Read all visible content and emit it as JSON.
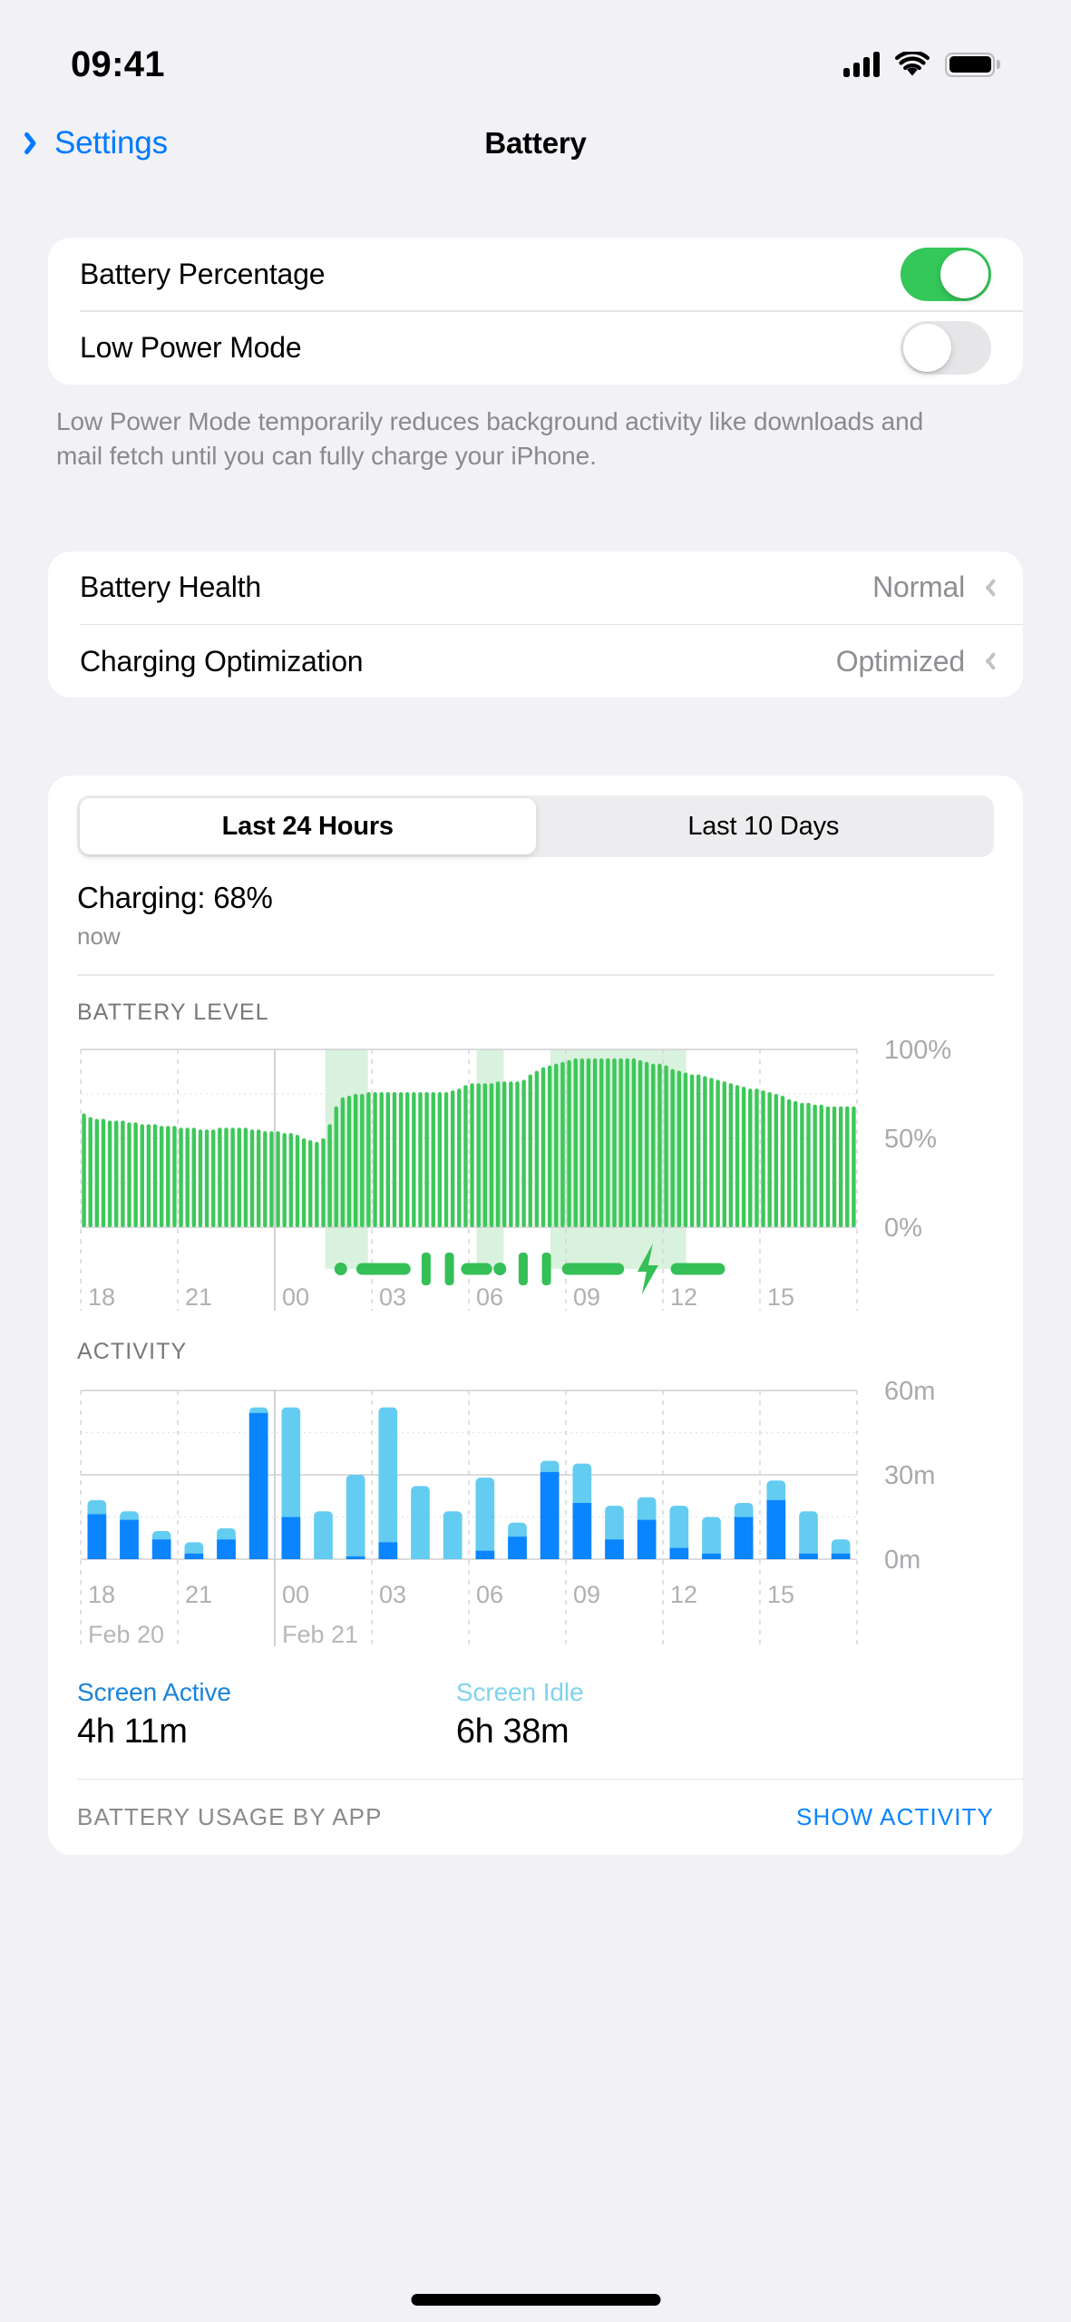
{
  "status_bar": {
    "time": "09:41",
    "cellular_icon": "cellular-bars-icon",
    "wifi_icon": "wifi-icon",
    "battery_icon": "battery-full-icon"
  },
  "nav": {
    "back_label": "Settings",
    "title": "Battery"
  },
  "settings_card": {
    "rows": [
      {
        "label": "Battery Percentage",
        "toggle": "on"
      },
      {
        "label": "Low Power Mode",
        "toggle": "off"
      }
    ]
  },
  "footnote": "Low Power Mode temporarily reduces background activity like downloads and mail fetch until you can fully charge your iPhone.",
  "health_card": {
    "rows": [
      {
        "label": "Battery Health",
        "value": "Normal"
      },
      {
        "label": "Charging Optimization",
        "value": "Optimized"
      }
    ]
  },
  "usage": {
    "segments": [
      {
        "label": "Last 24 Hours",
        "selected": true
      },
      {
        "label": "Last 10 Days",
        "selected": false
      }
    ],
    "charging_status": "Charging: 68%",
    "charging_time": "now",
    "battery_level_title": "BATTERY LEVEL",
    "activity_title": "ACTIVITY",
    "legend": [
      {
        "name": "Screen Active",
        "value": "4h 11m",
        "color": "#1a84d8"
      },
      {
        "name": "Screen Idle",
        "value": "6h 38m",
        "color": "#7fd3ea"
      }
    ],
    "by_app_title": "BATTERY USAGE BY APP",
    "show_activity_label": "SHOW ACTIVITY"
  },
  "colors": {
    "accent": "#007aff",
    "toggle_on": "#34c759",
    "battery_green": "#3ec75a",
    "screen_active": "#0a84ff",
    "screen_idle": "#64ccf0",
    "background": "#f1f1f6"
  },
  "chart_data": [
    {
      "type": "bar",
      "title": "BATTERY LEVEL",
      "ylabel": "",
      "ylim": [
        0,
        100
      ],
      "ytick_labels": [
        "100%",
        "50%",
        "0%"
      ],
      "ytick_values": [
        100,
        50,
        0
      ],
      "xlabel": "",
      "xtick_labels": [
        "18",
        "21",
        "00",
        "03",
        "06",
        "09",
        "12",
        "15"
      ],
      "grid": true,
      "bar_color": "#3ec75a",
      "values": [
        64,
        62,
        61,
        61,
        60,
        60,
        60,
        59,
        59,
        58,
        58,
        58,
        57,
        57,
        57,
        56,
        56,
        56,
        55,
        55,
        55,
        56,
        56,
        56,
        56,
        56,
        55,
        55,
        54,
        54,
        54,
        53,
        53,
        52,
        50,
        49,
        48,
        50,
        58,
        68,
        73,
        74,
        75,
        75,
        76,
        76,
        76,
        76,
        76,
        76,
        76,
        76,
        76,
        76,
        76,
        76,
        76,
        77,
        78,
        80,
        81,
        81,
        81,
        81,
        82,
        82,
        82,
        82,
        83,
        86,
        88,
        90,
        91,
        92,
        93,
        94,
        95,
        95,
        95,
        95,
        95,
        95,
        95,
        95,
        95,
        95,
        94,
        93,
        92,
        92,
        91,
        89,
        88,
        87,
        86,
        86,
        85,
        84,
        83,
        82,
        81,
        80,
        79,
        78,
        78,
        77,
        76,
        75,
        74,
        72,
        71,
        70,
        70,
        69,
        69,
        68,
        68,
        68,
        68,
        68
      ],
      "charging_regions": [
        {
          "start_pct": 31.5,
          "end_pct": 37.0
        },
        {
          "start_pct": 51.0,
          "end_pct": 54.5
        },
        {
          "start_pct": 60.5,
          "end_pct": 78.0
        }
      ],
      "charging_markers": [
        {
          "type": "dot",
          "pos_pct": 33.5
        },
        {
          "type": "line",
          "start_pct": 35.5,
          "end_pct": 42.5
        },
        {
          "type": "pause",
          "pos_pct": 44.5
        },
        {
          "type": "pause",
          "pos_pct": 47.5
        },
        {
          "type": "line",
          "start_pct": 49.0,
          "end_pct": 53.0
        },
        {
          "type": "dot",
          "pos_pct": 54.0
        },
        {
          "type": "pause",
          "pos_pct": 57.0
        },
        {
          "type": "pause",
          "pos_pct": 60.0
        },
        {
          "type": "line",
          "start_pct": 62.0,
          "end_pct": 70.0
        },
        {
          "type": "bolt",
          "pos_pct": 73.0
        },
        {
          "type": "line",
          "start_pct": 76.0,
          "end_pct": 83.0
        }
      ]
    },
    {
      "type": "bar",
      "title": "ACTIVITY",
      "ylabel": "",
      "ylim": [
        0,
        60
      ],
      "ytick_labels": [
        "60m",
        "30m",
        "0m"
      ],
      "ytick_values": [
        60,
        30,
        0
      ],
      "xlabel": "",
      "xtick_labels": [
        "18",
        "21",
        "00",
        "03",
        "06",
        "09",
        "12",
        "15"
      ],
      "date_labels": [
        "Feb 20",
        "Feb 21"
      ],
      "grid": true,
      "stacked": true,
      "series": [
        {
          "name": "Screen Active",
          "color": "#0a84ff",
          "values": [
            16,
            14,
            7,
            2,
            7,
            52,
            15,
            0,
            1,
            6,
            0,
            0,
            3,
            8,
            31,
            20,
            7,
            14,
            4,
            2,
            15,
            21,
            2,
            2
          ]
        },
        {
          "name": "Screen Idle",
          "color": "#64ccf0",
          "values": [
            5,
            3,
            3,
            4,
            4,
            2,
            39,
            17,
            29,
            48,
            26,
            17,
            26,
            5,
            4,
            14,
            12,
            8,
            15,
            13,
            5,
            7,
            15,
            5
          ]
        }
      ],
      "totals": [
        21,
        17,
        10,
        6,
        11,
        54,
        54,
        17,
        30,
        54,
        26,
        17,
        29,
        13,
        35,
        34,
        19,
        22,
        19,
        15,
        20,
        28,
        17,
        7
      ]
    }
  ]
}
